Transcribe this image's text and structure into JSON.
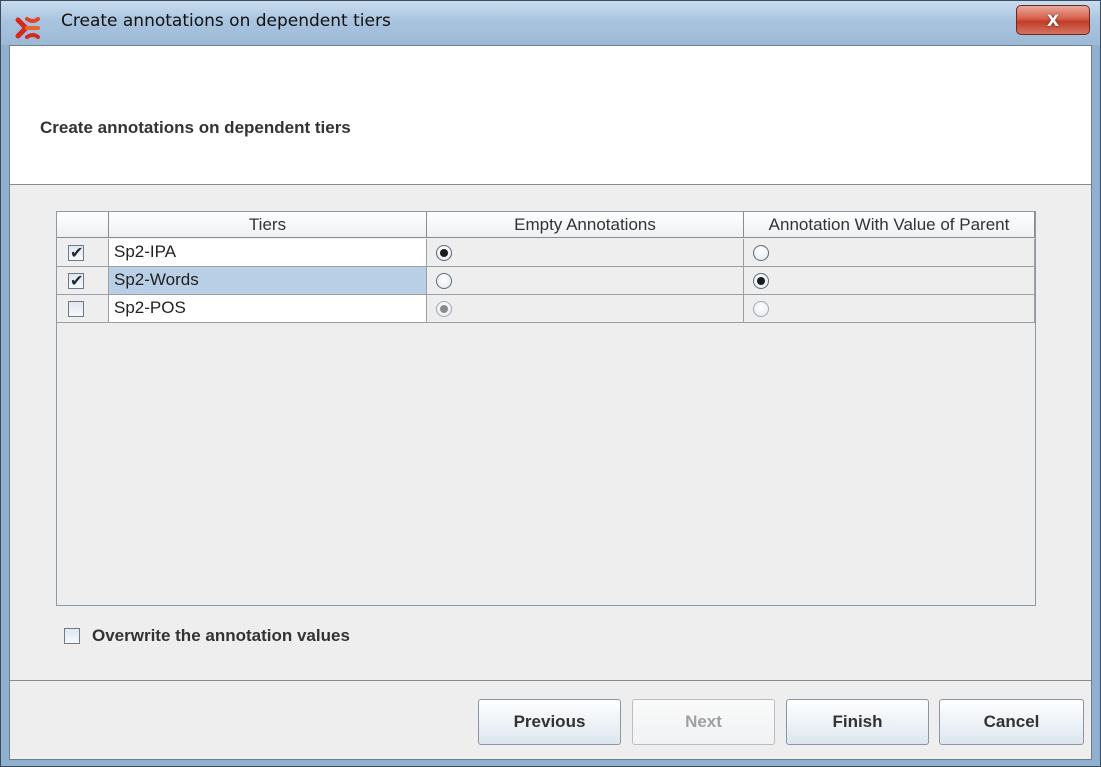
{
  "window": {
    "title": "Create annotations on dependent tiers",
    "close_label": "X"
  },
  "header": {
    "title": "Create annotations on dependent tiers"
  },
  "table": {
    "columns": [
      "",
      "Tiers",
      "Empty Annotations",
      "Annotation With Value of Parent"
    ],
    "rows": [
      {
        "checked": true,
        "tier": "Sp2-IPA",
        "mode": "empty",
        "enabled": true,
        "selected": false
      },
      {
        "checked": true,
        "tier": "Sp2-Words",
        "mode": "parent",
        "enabled": true,
        "selected": true
      },
      {
        "checked": false,
        "tier": "Sp2-POS",
        "mode": "empty",
        "enabled": false,
        "selected": false
      }
    ]
  },
  "options": {
    "overwrite_label": "Overwrite the annotation values",
    "overwrite_checked": false
  },
  "buttons": {
    "previous": "Previous",
    "next": "Next",
    "finish": "Finish",
    "cancel": "Cancel"
  },
  "colors": {
    "selection": "#b8cfe5",
    "close_button": "#c13e28"
  }
}
